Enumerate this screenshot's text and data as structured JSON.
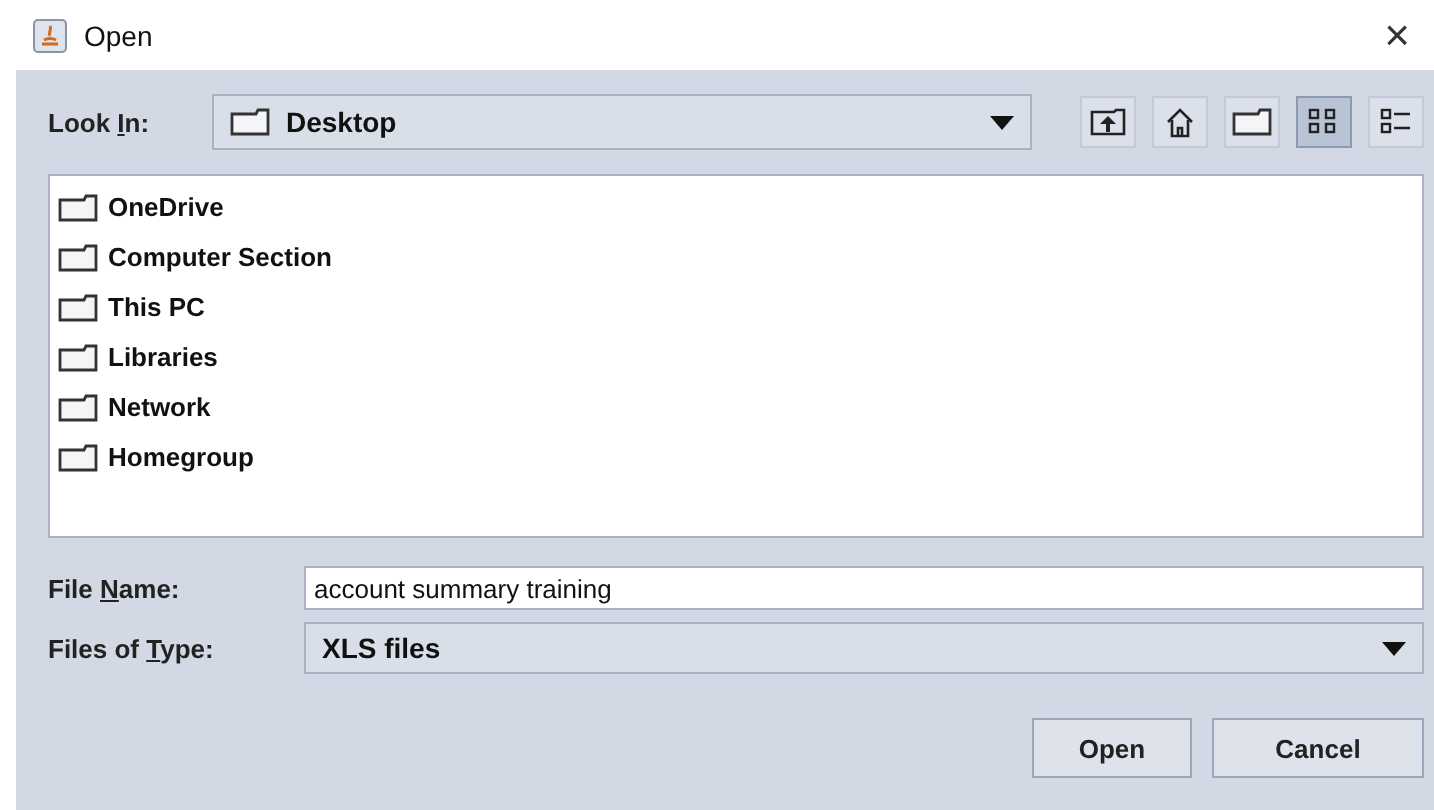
{
  "window": {
    "title": "Open",
    "close_glyph": "×"
  },
  "look_in": {
    "label": [
      "Look ",
      "I",
      "n:"
    ],
    "value": "Desktop"
  },
  "toolbar": [
    {
      "kind": "up",
      "selected": false
    },
    {
      "kind": "home",
      "selected": false
    },
    {
      "kind": "new_folder",
      "selected": false
    },
    {
      "kind": "list_view",
      "selected": true
    },
    {
      "kind": "details_view",
      "selected": false
    }
  ],
  "files": [
    {
      "name": "OneDrive"
    },
    {
      "name": "Computer Section"
    },
    {
      "name": "This PC"
    },
    {
      "name": "Libraries"
    },
    {
      "name": "Network"
    },
    {
      "name": "Homegroup"
    }
  ],
  "file_name": {
    "label": [
      "File ",
      "N",
      "ame:"
    ],
    "value": "account summary training"
  },
  "file_type": {
    "label": [
      "Files of ",
      "T",
      "ype:"
    ],
    "value": "XLS files"
  },
  "buttons": [
    "Open",
    "Cancel"
  ]
}
